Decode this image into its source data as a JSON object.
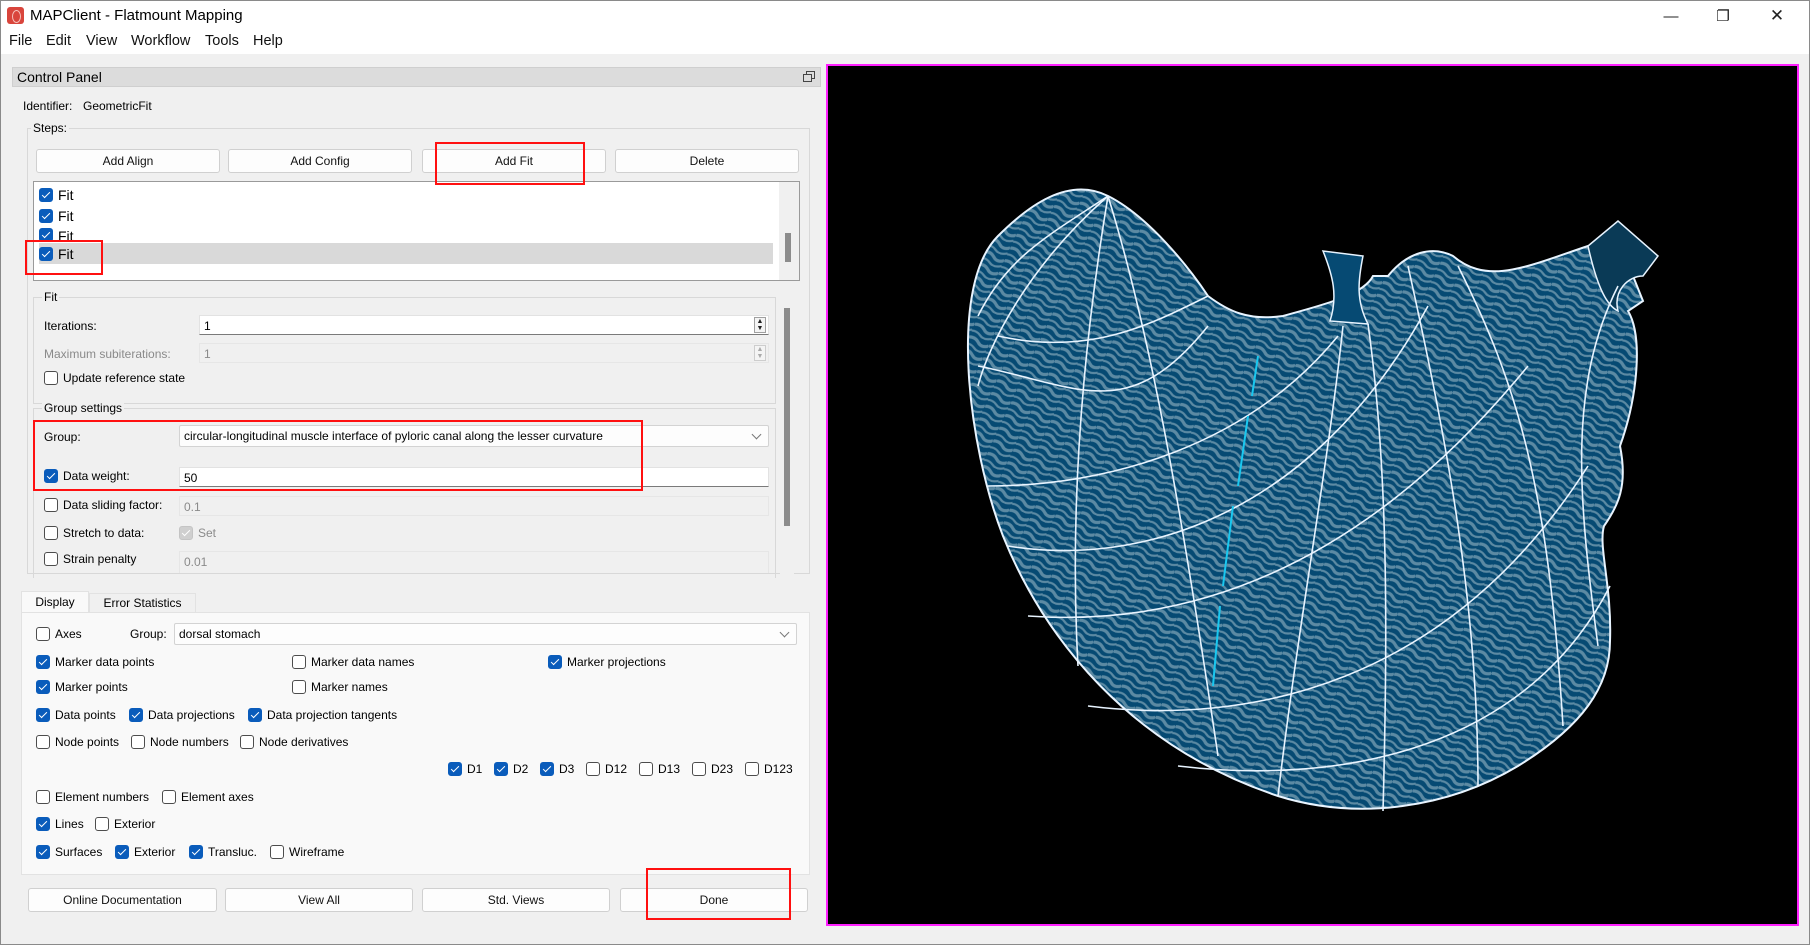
{
  "window": {
    "title": "MAPClient - Flatmount Mapping",
    "controls": {
      "minimize": "—",
      "restore": "❐",
      "close": "✕"
    }
  },
  "menu": [
    "File",
    "Edit",
    "View",
    "Workflow",
    "Tools",
    "Help"
  ],
  "control_panel": {
    "title": "Control Panel",
    "identifier_label": "Identifier:",
    "identifier_value": "GeometricFit",
    "steps_label": "Steps:",
    "step_buttons": [
      "Add Align",
      "Add Config",
      "Add Fit",
      "Delete"
    ],
    "steps": [
      {
        "label": "Fit",
        "checked": true,
        "selected": false
      },
      {
        "label": "Fit",
        "checked": true,
        "selected": false
      },
      {
        "label": "Fit",
        "checked": true,
        "selected": false
      },
      {
        "label": "Fit",
        "checked": true,
        "selected": true
      }
    ],
    "fit": {
      "title": "Fit",
      "iterations_label": "Iterations:",
      "iterations_value": "1",
      "max_subiterations_label": "Maximum subiterations:",
      "max_subiterations_value": "1",
      "update_reference_label": "Update reference state",
      "update_reference_checked": false
    },
    "group_settings": {
      "title": "Group settings",
      "group_label": "Group:",
      "group_value": "circular-longitudinal muscle interface of pyloric canal along the lesser curvature",
      "data_weight_label": "Data weight:",
      "data_weight_checked": true,
      "data_weight_value": "50",
      "data_sliding_label": "Data sliding factor:",
      "data_sliding_checked": false,
      "data_sliding_value": "0.1",
      "stretch_label": "Stretch to data:",
      "stretch_checked": false,
      "stretch_set_label": "Set",
      "strain_label": "Strain penalty",
      "strain_checked": false,
      "strain_value": "0.01"
    }
  },
  "tabs": [
    {
      "label": "Display",
      "active": true
    },
    {
      "label": "Error Statistics",
      "active": false
    }
  ],
  "display": {
    "axes_label": "Axes",
    "axes_checked": false,
    "group_label": "Group:",
    "group_value": "dorsal stomach",
    "marker_data_points": {
      "label": "Marker data points",
      "checked": true
    },
    "marker_data_names": {
      "label": "Marker data names",
      "checked": false
    },
    "marker_projections": {
      "label": "Marker projections",
      "checked": true
    },
    "marker_points": {
      "label": "Marker points",
      "checked": true
    },
    "marker_names": {
      "label": "Marker names",
      "checked": false
    },
    "data_points": {
      "label": "Data points",
      "checked": true
    },
    "data_projections": {
      "label": "Data projections",
      "checked": true
    },
    "data_projection_tangents": {
      "label": "Data projection tangents",
      "checked": true
    },
    "node_points": {
      "label": "Node points",
      "checked": false
    },
    "node_numbers": {
      "label": "Node numbers",
      "checked": false
    },
    "node_derivatives": {
      "label": "Node derivatives",
      "checked": false
    },
    "derivatives": [
      {
        "label": "D1",
        "checked": true
      },
      {
        "label": "D2",
        "checked": true
      },
      {
        "label": "D3",
        "checked": true
      },
      {
        "label": "D12",
        "checked": false
      },
      {
        "label": "D13",
        "checked": false
      },
      {
        "label": "D23",
        "checked": false
      },
      {
        "label": "D123",
        "checked": false
      }
    ],
    "element_numbers": {
      "label": "Element numbers",
      "checked": false
    },
    "element_axes": {
      "label": "Element axes",
      "checked": false
    },
    "lines": {
      "label": "Lines",
      "checked": true
    },
    "lines_exterior": {
      "label": "Exterior",
      "checked": false
    },
    "surfaces": {
      "label": "Surfaces",
      "checked": true
    },
    "surfaces_exterior": {
      "label": "Exterior",
      "checked": true
    },
    "transluc": {
      "label": "Transluc.",
      "checked": true
    },
    "wireframe": {
      "label": "Wireframe",
      "checked": false
    }
  },
  "bottom_buttons": [
    "Online Documentation",
    "View All",
    "Std. Views",
    "Done"
  ],
  "viewer": {
    "description": "3D stomach scaffold mesh fitted to flatmount data",
    "colors": {
      "background": "#000000",
      "border": "#ff20ff",
      "surface": "#064a73",
      "surface_light": "#5c8aa3",
      "mesh_lines": "#e8f4ff",
      "projections": "#19c8f0"
    }
  },
  "annotations": {
    "highlight_color": "#ff1010"
  }
}
